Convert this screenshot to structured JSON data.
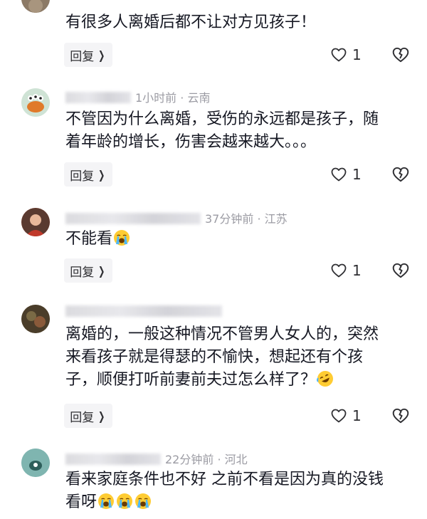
{
  "reply_label": "回复",
  "comments": [
    {
      "text": "有很多人离婚后都不让对方见孩子！",
      "likes": "1",
      "avatar_color": "#8c7a66"
    },
    {
      "meta": "1小时前 · 云南",
      "text_line1": "不管因为什么离婚，受伤的永远都是孩子，随",
      "text_line2": "着年龄的增长，伤害会越来越大。。。",
      "likes": "1",
      "avatar_color": "#cfe3d5"
    },
    {
      "meta": "37分钟前 · 江苏",
      "text": "不能看",
      "likes": "1",
      "avatar_color": "#b8503a"
    },
    {
      "text_line1": "离婚的，一般这种情况不管男人女人的，突然",
      "text_line2": "来看孩子就是得瑟的不愉快，想起还有个孩",
      "text_line3": "子，顺便打听前妻前夫过怎么样了？",
      "likes": "1",
      "avatar_color": "#6a5a3c"
    },
    {
      "meta": "22分钟前 · 河北",
      "text_line1": "看来家庭条件也不好 之前不看是因为真的没钱",
      "text_line2": "看呀",
      "avatar_color": "#7fb5b0"
    }
  ],
  "icons": {
    "like": "heart-outline-icon",
    "dislike": "broken-heart-icon",
    "emoji": "loudly-crying-emoji",
    "emoji_laugh": "rolling-on-floor-laughing-emoji"
  }
}
